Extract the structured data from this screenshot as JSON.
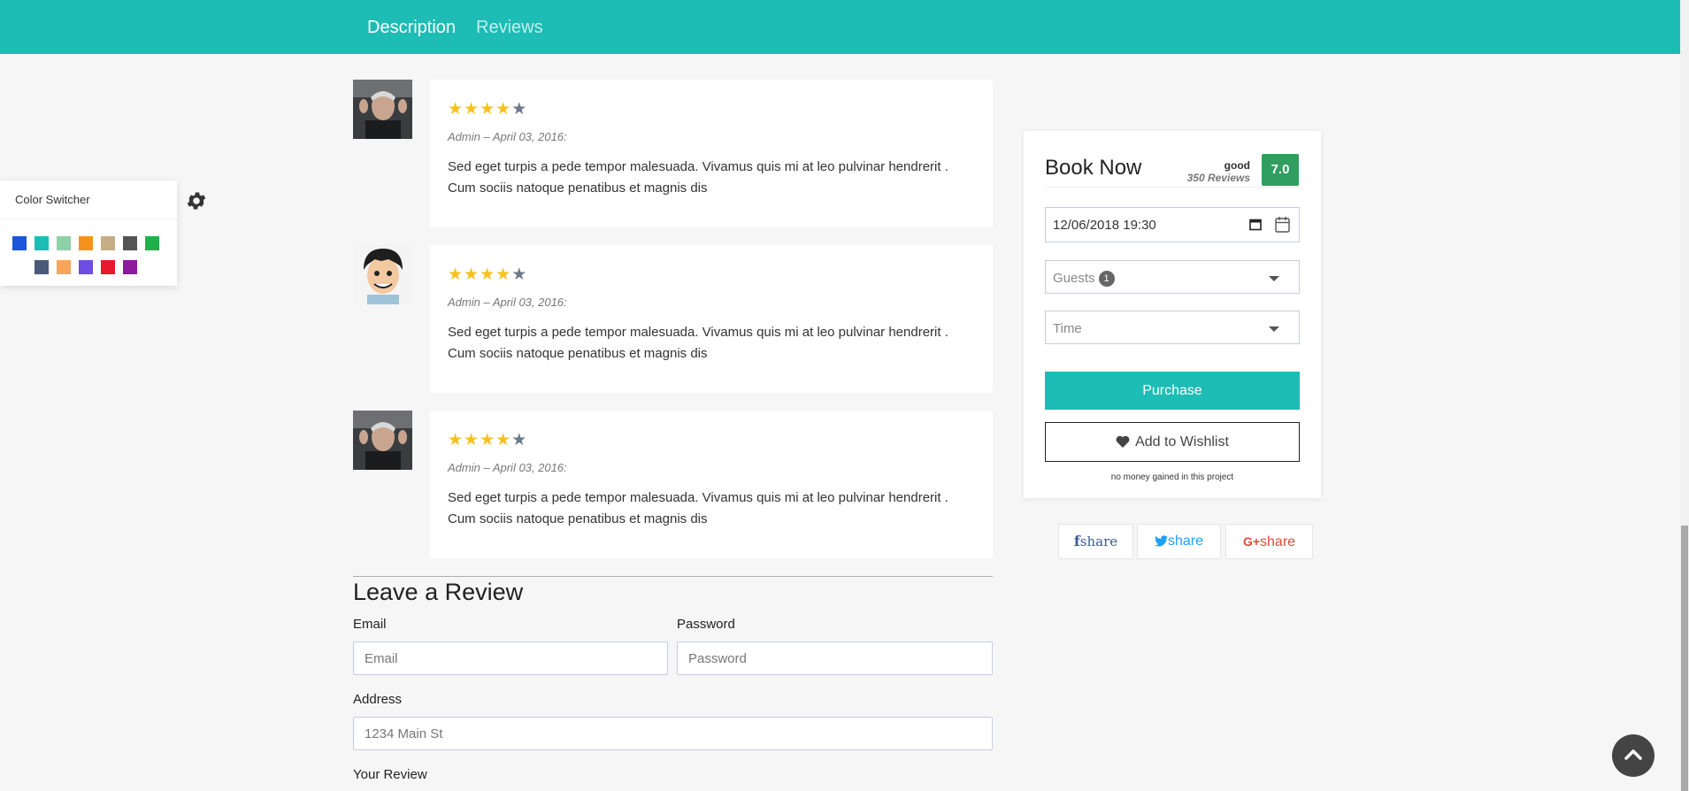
{
  "tabs": {
    "description": "Description",
    "reviews": "Reviews"
  },
  "reviews": [
    {
      "rating": 4,
      "meta": "Admin – April 03, 2016:",
      "text": "Sed eget turpis a pede tempor malesuada. Vivamus quis mi at leo pulvinar hendrerit . Cum sociis natoque penatibus et magnis dis"
    },
    {
      "rating": 4,
      "meta": "Admin – April 03, 2016:",
      "text": "Sed eget turpis a pede tempor malesuada. Vivamus quis mi at leo pulvinar hendrerit . Cum sociis natoque penatibus et magnis dis"
    },
    {
      "rating": 4,
      "meta": "Admin – April 03, 2016:",
      "text": "Sed eget turpis a pede tempor malesuada. Vivamus quis mi at leo pulvinar hendrerit . Cum sociis natoque penatibus et magnis dis"
    }
  ],
  "color_switcher": {
    "title": "Color Switcher",
    "colors": [
      "#1a56db",
      "#1dbcb5",
      "#8fd0a8",
      "#f5921e",
      "#c5ad86",
      "#555555",
      "#20b04b",
      "#4a5a78",
      "#f5a55c",
      "#6c4ee3",
      "#e8192c",
      "#8e1b9e"
    ]
  },
  "booking": {
    "title": "Book Now",
    "rating_word": "good",
    "reviews_count": "350 Reviews",
    "score": "7.0",
    "datetime": "12/06/2018 19:30",
    "guests_label": "Guests",
    "guests_count": "1",
    "time_placeholder": "Time",
    "purchase_label": "Purchase",
    "wishlist_label": "Add to Wishlist",
    "note": "no money gained in this project"
  },
  "share": {
    "facebook": "share",
    "twitter": "share",
    "google": "share",
    "google_prefix": "G+"
  },
  "review_form": {
    "heading": "Leave a Review",
    "email_label": "Email",
    "email_placeholder": "Email",
    "password_label": "Password",
    "password_placeholder": "Password",
    "address_label": "Address",
    "address_placeholder": "1234 Main St",
    "review_label": "Your Review"
  }
}
